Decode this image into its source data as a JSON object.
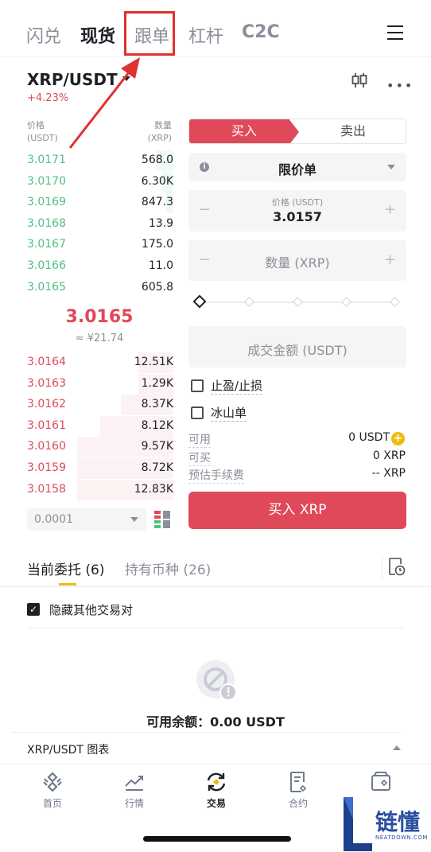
{
  "top_tabs": {
    "flash": "闪兑",
    "spot": "现货",
    "copy": "跟单",
    "margin": "杠杆",
    "c2c": "C2C"
  },
  "pair": {
    "symbol": "XRP/USDT",
    "change": "+4.23%"
  },
  "order_book": {
    "price_header": [
      "价格",
      "(USDT)"
    ],
    "qty_header": [
      "数量",
      "(XRP)"
    ],
    "bids": [
      {
        "price": "3.0171",
        "qty": "568.0",
        "depth": 0.12
      },
      {
        "price": "3.0170",
        "qty": "6.30K",
        "depth": 0.08
      },
      {
        "price": "3.0169",
        "qty": "847.3",
        "depth": 0.05
      },
      {
        "price": "3.0168",
        "qty": "13.9",
        "depth": 0.0
      },
      {
        "price": "3.0167",
        "qty": "175.0",
        "depth": 0.0
      },
      {
        "price": "3.0166",
        "qty": "11.0",
        "depth": 0.0
      },
      {
        "price": "3.0165",
        "qty": "605.8",
        "depth": 0.0
      }
    ],
    "last_price": "3.0165",
    "last_fiat": "≈ ¥21.74",
    "asks": [
      {
        "price": "3.0164",
        "qty": "12.51K",
        "depth": 0.24
      },
      {
        "price": "3.0163",
        "qty": "1.29K",
        "depth": 0.24
      },
      {
        "price": "3.0162",
        "qty": "8.37K",
        "depth": 0.36
      },
      {
        "price": "3.0161",
        "qty": "8.12K",
        "depth": 0.5
      },
      {
        "price": "3.0160",
        "qty": "9.57K",
        "depth": 0.66
      },
      {
        "price": "3.0159",
        "qty": "8.72K",
        "depth": 0.66
      },
      {
        "price": "3.0158",
        "qty": "12.83K",
        "depth": 0.66
      }
    ],
    "precision": "0.0001"
  },
  "trade_form": {
    "buy_tab": "买入",
    "sell_tab": "卖出",
    "order_type": "限价单",
    "price_caption": "价格 (USDT)",
    "price_value": "3.0157",
    "qty_placeholder": "数量 (XRP)",
    "amount_placeholder": "成交金额 (USDT)",
    "tp_sl_label": "止盈/止损",
    "iceberg_label": "冰山单",
    "available_label": "可用",
    "available_value": "0 USDT",
    "can_buy_label": "可买",
    "can_buy_value": "0 XRP",
    "fee_label": "预估手续费",
    "fee_value": "-- XRP",
    "buy_button": "买入 XRP",
    "minus": "−",
    "plus": "+"
  },
  "orders": {
    "current_tab": "当前委托 (6)",
    "holdings_tab": "持有币种 (26)",
    "hide_others": "隐藏其他交易对",
    "balance": "可用余额：0.00 USDT"
  },
  "chart_bar": {
    "label": "XRP/USDT 图表"
  },
  "bottom_nav": {
    "home": "首页",
    "markets": "行情",
    "trade": "交易",
    "futures": "合约",
    "wallet": "钱包"
  },
  "watermark": {
    "text": "链懂",
    "sub": "NEATDOWN.COM"
  },
  "colors": {
    "buy_red": "#e0495a",
    "bid_green": "#4fbf86",
    "accent_yellow": "#f0b90b",
    "annotation_red": "#e0322e"
  }
}
